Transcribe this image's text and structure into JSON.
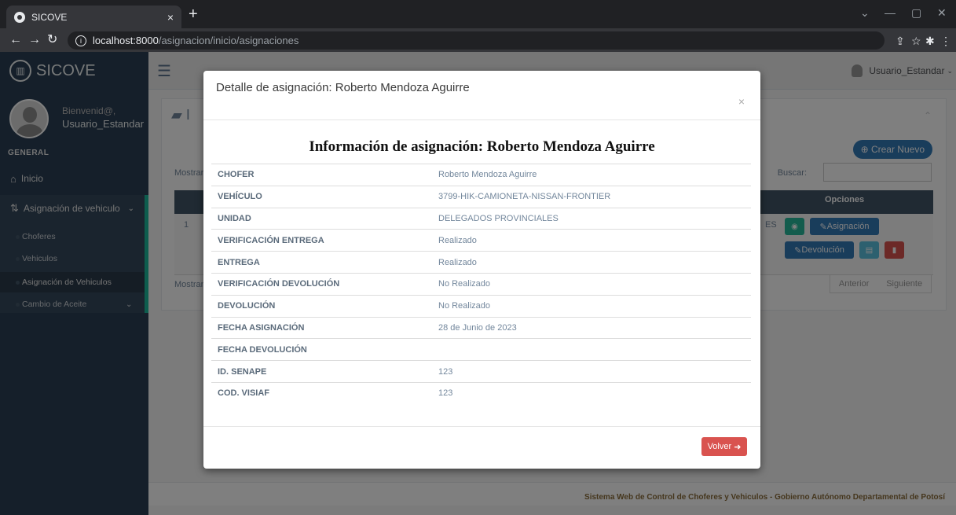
{
  "browser": {
    "tab_title": "SICOVE",
    "url_host": "localhost:8000",
    "url_path": "/asignacion/inicio/asignaciones"
  },
  "sidebar": {
    "brand": "SICOVE",
    "welcome": "Bienvenid@,",
    "user": "Usuario_Estandar",
    "section": "GENERAL",
    "items": [
      {
        "label": "Inicio"
      },
      {
        "label": "Asignación de vehiculo"
      },
      {
        "label": "Cambio de Aceite"
      }
    ],
    "subitems": [
      {
        "label": "Choferes"
      },
      {
        "label": "Vehiculos"
      },
      {
        "label": "Asignación de Vehiculos"
      }
    ]
  },
  "topnav": {
    "user": "Usuario_Estandar"
  },
  "page": {
    "crear": "Crear Nuevo",
    "mostrar_top": "Mostrar",
    "buscar": "Buscar:",
    "opciones": "Opciones",
    "row_num": "1",
    "row_tail": "ES",
    "btn_asignacion": "Asignación",
    "btn_devolucion": "Devolución",
    "mostrar_bottom": "Mostran",
    "anterior": "Anterior",
    "siguiente": "Siguiente",
    "footer": "Sistema Web de Control de Choferes y Vehiculos - Gobierno Autónomo Departamental de Potosí"
  },
  "modal": {
    "title": "Detalle de asignación: Roberto Mendoza Aguirre",
    "heading": "Información de asignación: Roberto Mendoza Aguirre",
    "rows": [
      {
        "key": "CHOFER",
        "value": "Roberto Mendoza Aguirre"
      },
      {
        "key": "VEHÍCULO",
        "value": "3799-HIK-CAMIONETA-NISSAN-FRONTIER"
      },
      {
        "key": "UNIDAD",
        "value": "DELEGADOS PROVINCIALES"
      },
      {
        "key": "VERIFICACIÓN ENTREGA",
        "value": "Realizado"
      },
      {
        "key": "ENTREGA",
        "value": "Realizado"
      },
      {
        "key": "VERIFICACIÓN DEVOLUCIÓN",
        "value": "No Realizado"
      },
      {
        "key": "DEVOLUCIÓN",
        "value": "No Realizado"
      },
      {
        "key": "FECHA ASIGNACIÓN",
        "value": "28 de Junio de 2023"
      },
      {
        "key": "FECHA DEVOLUCIÓN",
        "value": ""
      },
      {
        "key": "ID. SENAPE",
        "value": "123"
      },
      {
        "key": "COD. VISIAF",
        "value": "123"
      }
    ],
    "volver": "Volver"
  }
}
